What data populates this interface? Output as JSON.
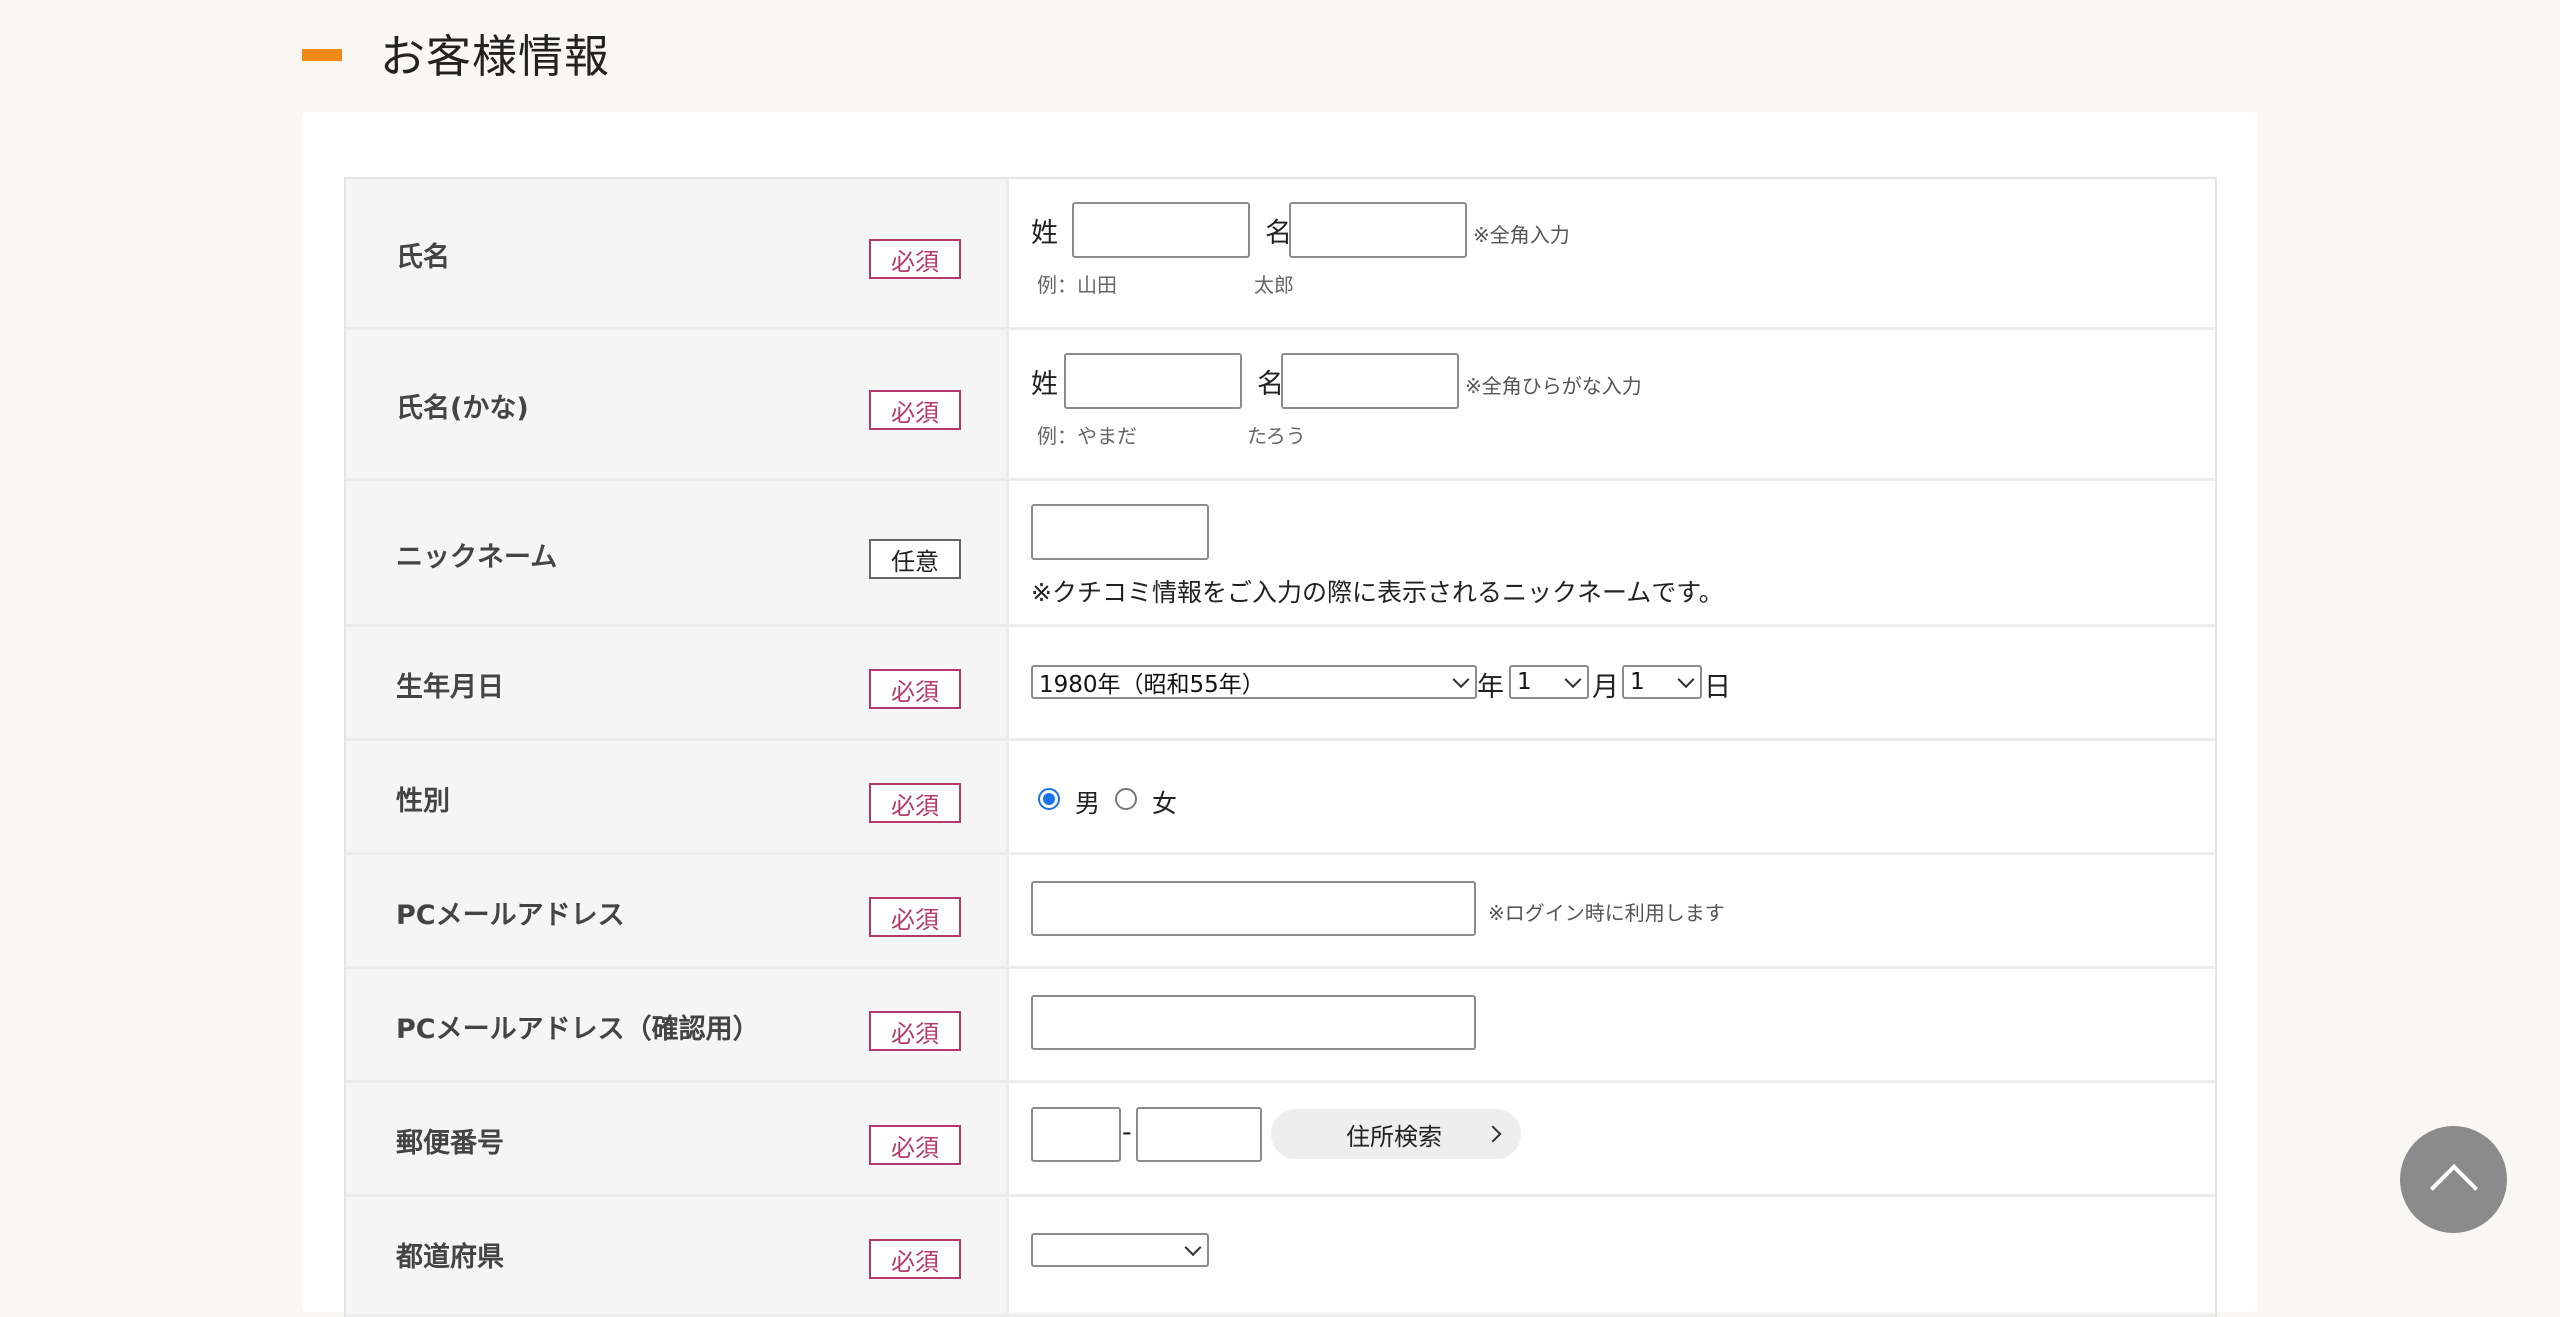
{
  "section": {
    "title": "お客様情報"
  },
  "fields": {
    "name": {
      "label": "氏名",
      "badge": "必須",
      "sei_label": "姓",
      "mei_label": "名",
      "note": "※全角入力",
      "example_prefix": "例：山田",
      "example_mei": "太郎"
    },
    "kana": {
      "label": "氏名(かな)",
      "badge": "必須",
      "sei_label": "姓",
      "mei_label": "名",
      "note": "※全角ひらがな入力",
      "example_prefix": "例：やまだ",
      "example_mei": "たろう"
    },
    "nickname": {
      "label": "ニックネーム",
      "badge": "任意",
      "note": "※クチコミ情報をご入力の際に表示されるニックネームです。"
    },
    "birthday": {
      "label": "生年月日",
      "badge": "必須",
      "year_value": "1980年（昭和55年）",
      "year_suffix": "年",
      "month_value": "1",
      "month_suffix": "月",
      "day_value": "1",
      "day_suffix": "日"
    },
    "gender": {
      "label": "性別",
      "badge": "必須",
      "options": [
        "男",
        "女"
      ],
      "selected": "男"
    },
    "email": {
      "label": "PCメールアドレス",
      "badge": "必須",
      "note": "※ログイン時に利用します"
    },
    "email_confirm": {
      "label": "PCメールアドレス（確認用）",
      "badge": "必須"
    },
    "postal": {
      "label": "郵便番号",
      "badge": "必須",
      "separator": "-",
      "search_button": "住所検索"
    },
    "prefecture": {
      "label": "都道府県",
      "badge": "必須"
    }
  },
  "icons": {
    "scroll_top": "chevron-up-icon",
    "button_arrow": "chevron-right-icon"
  },
  "colors": {
    "accent": "#f28a1a",
    "required_badge": "#b23a6b",
    "radio_checked": "#1a73e8"
  }
}
